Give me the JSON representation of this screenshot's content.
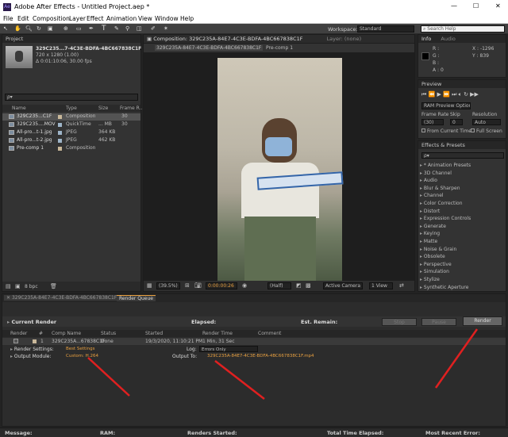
{
  "window": {
    "title": "Adobe After Effects - Untitled Project.aep *",
    "min": "—",
    "max": "☐",
    "close": "✕"
  },
  "menu": [
    "File",
    "Edit",
    "Composition",
    "Layer",
    "Effect",
    "Animation",
    "View",
    "Window",
    "Help"
  ],
  "toolbar": {
    "workspace_label": "Workspace:",
    "workspace_value": "Standard",
    "search_placeholder": "Search Help"
  },
  "project": {
    "tab": "Project",
    "item_name": "329C235...7-4C3E-BDFA-4BC667838C1F ▾",
    "item_dims": "720 x 1280 (1.00)",
    "item_duration": "Δ 0:01:10:06, 30.00 fps",
    "search_glyph": "ρ▾",
    "columns": {
      "name": "Name",
      "type": "Type",
      "size": "Size",
      "frame_rate": "Frame R..."
    },
    "items": [
      {
        "name": "329C235...C1F",
        "type": "Composition",
        "size": "",
        "fps": "30",
        "color": "#c9b89a",
        "selected": true
      },
      {
        "name": "329C235....MOV",
        "type": "QuickTime",
        "size": "... MB",
        "fps": "30",
        "color": "#9fb5c9",
        "selected": false
      },
      {
        "name": "All-pro...t-1.jpg",
        "type": "JPEG",
        "size": "364 KB",
        "fps": "",
        "color": "#9fb5c9",
        "selected": false
      },
      {
        "name": "All-pro...t-2.jpg",
        "type": "JPEG",
        "size": "462 KB",
        "fps": "",
        "color": "#9fb5c9",
        "selected": false
      },
      {
        "name": "Pre-comp 1",
        "type": "Composition",
        "size": "",
        "fps": "",
        "color": "#c9b89a",
        "selected": false
      }
    ],
    "bpc": "8 bpc"
  },
  "comp": {
    "tab": "Composition: 329C235A-84E7-4C3E-BDFA-4BC667838C1F",
    "layer_tab": "Layer: (none)",
    "subtab1": "329C235A-84E7-4C3E-BDFA-4BC667838C1F",
    "subtab2": "Pre-comp 1",
    "zoom": "(39.5%)",
    "timecode": "0:00:00:26",
    "quality": "(Half)",
    "camera": "Active Camera",
    "views": "1 View"
  },
  "info": {
    "tab": "Info",
    "audio_tab": "Audio",
    "r": "R :",
    "g": "G :",
    "b": "B :",
    "a": "A : 0",
    "x": "X : -1296",
    "y": "Y : 839"
  },
  "preview": {
    "tab": "Preview",
    "ram_options": "RAM Preview Options",
    "frame_rate_label": "Frame Rate",
    "skip_label": "Skip",
    "resolution_label": "Resolution",
    "frame_rate": "(30)",
    "skip": "0",
    "resolution": "Auto",
    "from_current": "From Current Time",
    "full_screen": "Full Screen"
  },
  "effects": {
    "tab": "Effects & Presets",
    "search_glyph": "ρ▾",
    "items": [
      "* Animation Presets",
      "3D Channel",
      "Audio",
      "Blur & Sharpen",
      "Channel",
      "Color Correction",
      "Distort",
      "Expression Controls",
      "Generate",
      "Keying",
      "Matte",
      "Noise & Grain",
      "Obsolete",
      "Perspective",
      "Simulation",
      "Stylize",
      "Synthetic Aperture"
    ]
  },
  "render_queue": {
    "timeline_tab": "329C235A-84E7-4C3E-BDFA-4BC667838C1F",
    "tab": "Render Queue",
    "current_render": "Current Render",
    "elapsed": "Elapsed:",
    "est_remain": "Est. Remain:",
    "stop": "Stop",
    "pause": "Pause",
    "render": "Render",
    "columns": {
      "render": "Render",
      "num": "#",
      "comp_name": "Comp Name",
      "status": "Status",
      "started": "Started",
      "render_time": "Render Time",
      "comment": "Comment"
    },
    "item": {
      "num": "1",
      "comp_name": "329C235A...67838C1F",
      "status": "Done",
      "started": "19/3/2020, 11:10:21 PM",
      "render_time": "1 Min, 31 Sec"
    },
    "render_settings_label": "Render Settings:",
    "render_settings_value": "Best Settings",
    "log_label": "Log:",
    "log_value": "Errors Only",
    "output_module_label": "Output Module:",
    "output_module_value": "Custom: H.264",
    "output_to_label": "Output To:",
    "output_to_value": "329C235A-84E7-4C3E-BDFA-4BC667838C1F.mp4"
  },
  "statusbar": {
    "message": "Message:",
    "ram": "RAM:",
    "renders_started": "Renders Started:",
    "total_time": "Total Time Elapsed:",
    "recent_error": "Most Recent Error:"
  },
  "colors": {
    "annotation": "#e02020",
    "accent": "#e8a040"
  }
}
